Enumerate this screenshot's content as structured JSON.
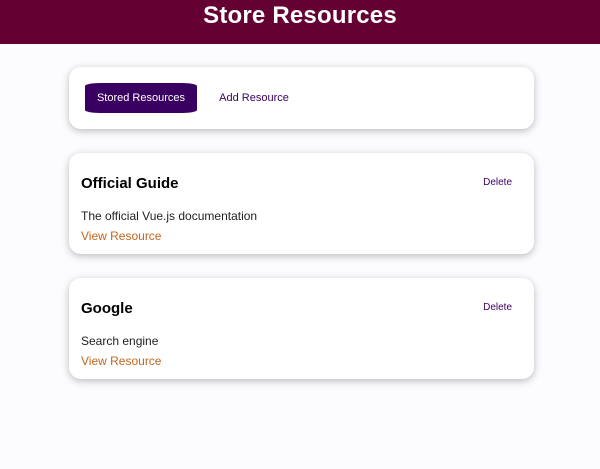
{
  "header": {
    "title": "Store Resources",
    "background_color": "#640032"
  },
  "tabs": {
    "stored_label": "Stored Resources",
    "add_label": "Add Resource",
    "active": "Stored Resources",
    "accent_color": "#3a0061"
  },
  "resources": [
    {
      "title": "Official Guide",
      "description": "The official Vue.js documentation",
      "link_label": "View Resource",
      "delete_label": "Delete"
    },
    {
      "title": "Google",
      "description": "Search engine",
      "link_label": "View Resource",
      "delete_label": "Delete"
    }
  ],
  "link_color": "#c2661e"
}
